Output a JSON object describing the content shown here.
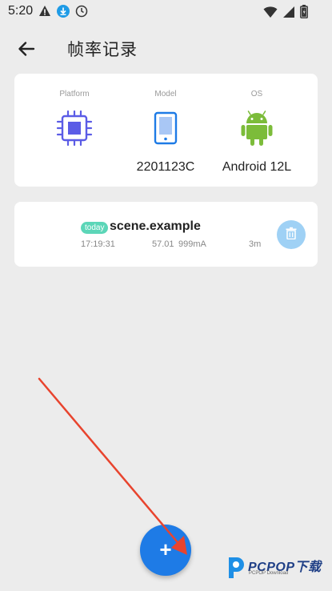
{
  "status_bar": {
    "time": "5:20",
    "left_icons": [
      "warning-icon",
      "download-icon",
      "clock-icon"
    ],
    "right_icons": [
      "wifi-icon",
      "signal-icon",
      "battery-icon"
    ]
  },
  "app_bar": {
    "title": "帧率记录",
    "back_icon": "arrow-left-icon"
  },
  "device_info": {
    "columns": [
      {
        "label": "Platform",
        "icon": "chip-icon",
        "value": "",
        "icon_color": "#5b5ce6"
      },
      {
        "label": "Model",
        "icon": "phone-icon",
        "value": "2201123C",
        "icon_color": "#1e7be6"
      },
      {
        "label": "OS",
        "icon": "android-icon",
        "value": "Android 12L",
        "icon_color": "#7cbc3a"
      }
    ]
  },
  "records": [
    {
      "badge": "today",
      "name": "scene.example",
      "time": "17:19:31",
      "fps": "57.01",
      "current": "999mA",
      "duration": "3m",
      "delete_icon": "trash-icon"
    }
  ],
  "fab": {
    "label": "+"
  },
  "watermark": {
    "text": "PCPOP下载",
    "subtext": "PCPOP Download"
  },
  "colors": {
    "background": "#ececec",
    "accent": "#1e7be6",
    "badge": "#5cd6b8",
    "delete_button": "#9fd1f5",
    "annotation_arrow": "#e8442e"
  }
}
